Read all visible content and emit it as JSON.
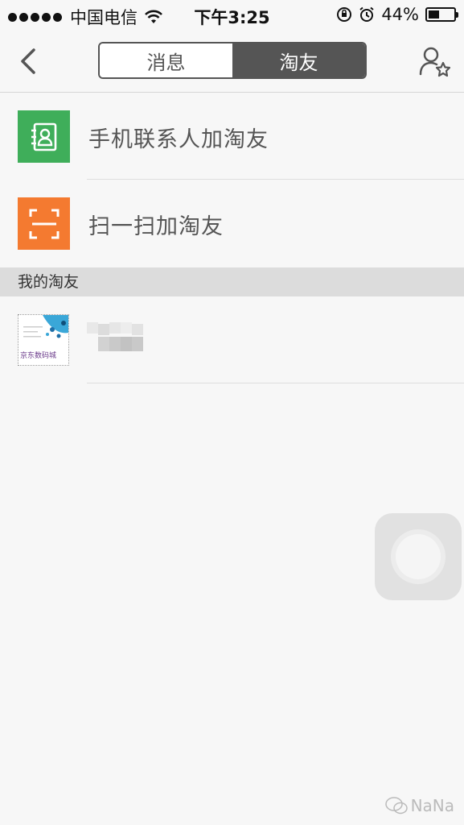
{
  "status_bar": {
    "carrier": "中国电信",
    "time": "下午3:25",
    "battery_text": "44%",
    "battery_level": 0.44
  },
  "nav": {
    "tabs": [
      {
        "label": "消息",
        "active": false
      },
      {
        "label": "淘友",
        "active": true
      }
    ]
  },
  "actions": [
    {
      "label": "手机联系人加淘友",
      "icon": "contacts-icon",
      "color": "#3fae5a"
    },
    {
      "label": "扫一扫加淘友",
      "icon": "scan-icon",
      "color": "#f47a30"
    }
  ],
  "section": {
    "title": "我的淘友"
  },
  "friends": [
    {
      "avatar_text": "京东数码城"
    }
  ],
  "watermark": {
    "text": "NaNa"
  }
}
